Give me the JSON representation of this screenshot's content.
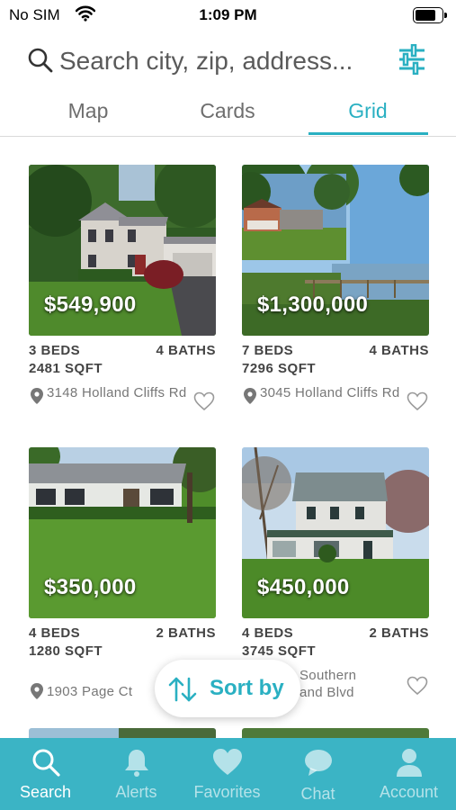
{
  "status_bar": {
    "carrier": "No SIM",
    "time": "1:09 PM"
  },
  "search": {
    "placeholder": "Search city, zip, address..."
  },
  "tabs": [
    {
      "label": "Map",
      "active": false
    },
    {
      "label": "Cards",
      "active": false
    },
    {
      "label": "Grid",
      "active": true
    }
  ],
  "listings": [
    {
      "price": "$549,900",
      "beds": "3 BEDS",
      "baths": "4 BATHS",
      "sqft": "2481 SQFT",
      "address": "3148 Holland Cliffs Rd"
    },
    {
      "price": "$1,300,000",
      "beds": "7 BEDS",
      "baths": "4 BATHS",
      "sqft": "7296 SQFT",
      "address": "3045 Holland Cliffs Rd"
    },
    {
      "price": "$350,000",
      "beds": "4 BEDS",
      "baths": "2 BATHS",
      "sqft": "1280 SQFT",
      "address": "1903 Page Ct"
    },
    {
      "price": "$450,000",
      "beds": "4 BEDS",
      "baths": "2 BATHS",
      "sqft": "3745 SQFT",
      "address": "Southern\nand Blvd"
    }
  ],
  "sort_button": {
    "label": "Sort by"
  },
  "bottom_nav": [
    {
      "label": "Search",
      "icon": "search-icon",
      "active": true
    },
    {
      "label": "Alerts",
      "icon": "bell-icon",
      "active": false
    },
    {
      "label": "Favorites",
      "icon": "heart-icon",
      "active": false
    },
    {
      "label": "Chat",
      "icon": "chat-bubble-icon",
      "active": false
    },
    {
      "label": "Account",
      "icon": "person-icon",
      "active": false
    }
  ],
  "colors": {
    "accent": "#2ab0c2",
    "nav_background": "#3bb4c5"
  }
}
